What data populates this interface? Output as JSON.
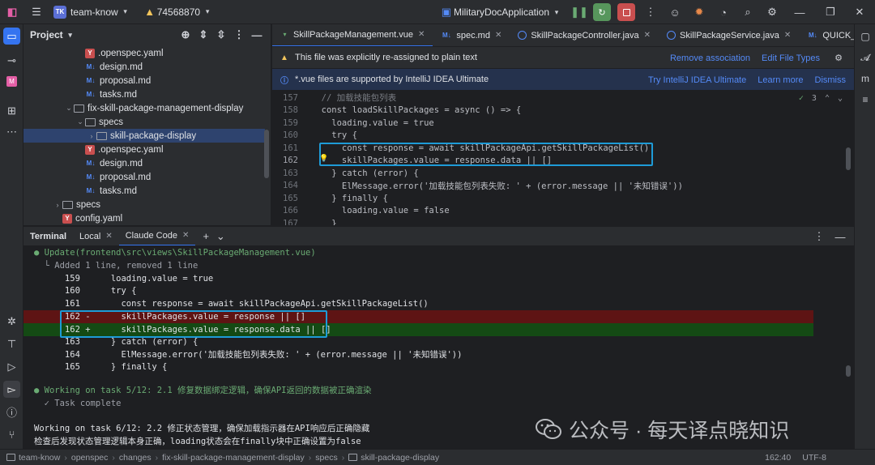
{
  "topbar": {
    "project_badge": "TK",
    "project_name": "team-know",
    "vcs_branch": "74568870",
    "run_config": "MilitaryDocApplication"
  },
  "project_panel": {
    "title": "Project",
    "tree": [
      {
        "label": ".openspec.yaml",
        "type": "yaml",
        "indent": 4
      },
      {
        "label": "design.md",
        "type": "md",
        "indent": 4
      },
      {
        "label": "proposal.md",
        "type": "md",
        "indent": 4
      },
      {
        "label": "tasks.md",
        "type": "md",
        "indent": 4
      },
      {
        "label": "fix-skill-package-management-display",
        "type": "folder",
        "indent": 3,
        "chevron": "v"
      },
      {
        "label": "specs",
        "type": "folder",
        "indent": 4,
        "chevron": "v"
      },
      {
        "label": "skill-package-display",
        "type": "folder",
        "indent": 5,
        "chevron": ">",
        "selected": true
      },
      {
        "label": ".openspec.yaml",
        "type": "yaml",
        "indent": 4
      },
      {
        "label": "design.md",
        "type": "md",
        "indent": 4
      },
      {
        "label": "proposal.md",
        "type": "md",
        "indent": 4
      },
      {
        "label": "tasks.md",
        "type": "md",
        "indent": 4
      },
      {
        "label": "specs",
        "type": "folder",
        "indent": 2,
        "chevron": ">"
      },
      {
        "label": "config.yaml",
        "type": "yaml",
        "indent": 2
      }
    ]
  },
  "editor": {
    "tabs": [
      {
        "label": "SkillPackageManagement.vue",
        "icon": "vue",
        "active": true
      },
      {
        "label": "spec.md",
        "icon": "md"
      },
      {
        "label": "SkillPackageController.java",
        "icon": "java"
      },
      {
        "label": "SkillPackageService.java",
        "icon": "java"
      },
      {
        "label": "QUICK_START_GUIDE.md",
        "icon": "md"
      }
    ],
    "banner1": {
      "text": "This file was explicitly re-assigned to plain text",
      "link1": "Remove association",
      "link2": "Edit File Types"
    },
    "banner2": {
      "text": "*.vue files are supported by IntelliJ IDEA Ultimate",
      "link1": "Try IntelliJ IDEA Ultimate",
      "link2": "Learn more",
      "link3": "Dismiss"
    },
    "inspection_count": "3",
    "lines": [
      {
        "n": "157",
        "code": "  // 加载技能包列表"
      },
      {
        "n": "158",
        "code": "  const loadSkillPackages = async () => {"
      },
      {
        "n": "159",
        "code": "    loading.value = true"
      },
      {
        "n": "160",
        "code": "    try {"
      },
      {
        "n": "161",
        "code": "      const response = await skillPackageApi.getSkillPackageList()"
      },
      {
        "n": "162",
        "code": "      skillPackages.value = response.data || []"
      },
      {
        "n": "163",
        "code": "    } catch (error) {"
      },
      {
        "n": "164",
        "code": "      ElMessage.error('加载技能包列表失败: ' + (error.message || '未知错误'))"
      },
      {
        "n": "165",
        "code": "    } finally {"
      },
      {
        "n": "166",
        "code": "      loading.value = false"
      },
      {
        "n": "167",
        "code": "    }"
      }
    ]
  },
  "terminal": {
    "tabs": [
      "Terminal",
      "Local",
      "Claude Code"
    ],
    "lines": [
      {
        "text": "● Update(frontend\\src\\views\\SkillPackageManagement.vue)"
      },
      {
        "text": "  └ Added 1 line, removed 1 line"
      },
      {
        "text": "      159      loading.value = true"
      },
      {
        "text": "      160      try {"
      },
      {
        "text": "      161        const response = await skillPackageApi.getSkillPackageList()"
      },
      {
        "text": "      162 -      skillPackages.value = response || []",
        "kind": "del"
      },
      {
        "text": "      162 +      skillPackages.value = response.data || []",
        "kind": "add"
      },
      {
        "text": "      163      } catch (error) {"
      },
      {
        "text": "      164        ElMessage.error('加载技能包列表失败: ' + (error.message || '未知错误'))"
      },
      {
        "text": "      165      } finally {"
      },
      {
        "text": ""
      },
      {
        "text": "● Working on task 5/12: 2.1 修复数据绑定逻辑，确保API返回的数据被正确渲染"
      },
      {
        "text": "  ✓ Task complete"
      },
      {
        "text": ""
      },
      {
        "text": "Working on task 6/12: 2.2 修正状态管理，确保加载指示器在API响应后正确隐藏"
      },
      {
        "text": "检查后发现状态管理逻辑本身正确，loading状态会在finally块中正确设置为false"
      }
    ]
  },
  "watermark": "公众号 · 每天译点晓知识",
  "statusbar": {
    "crumbs": [
      "team-know",
      "openspec",
      "changes",
      "fix-skill-package-management-display",
      "specs",
      "skill-package-display"
    ],
    "position": "162:40",
    "encoding": "UTF-8"
  }
}
